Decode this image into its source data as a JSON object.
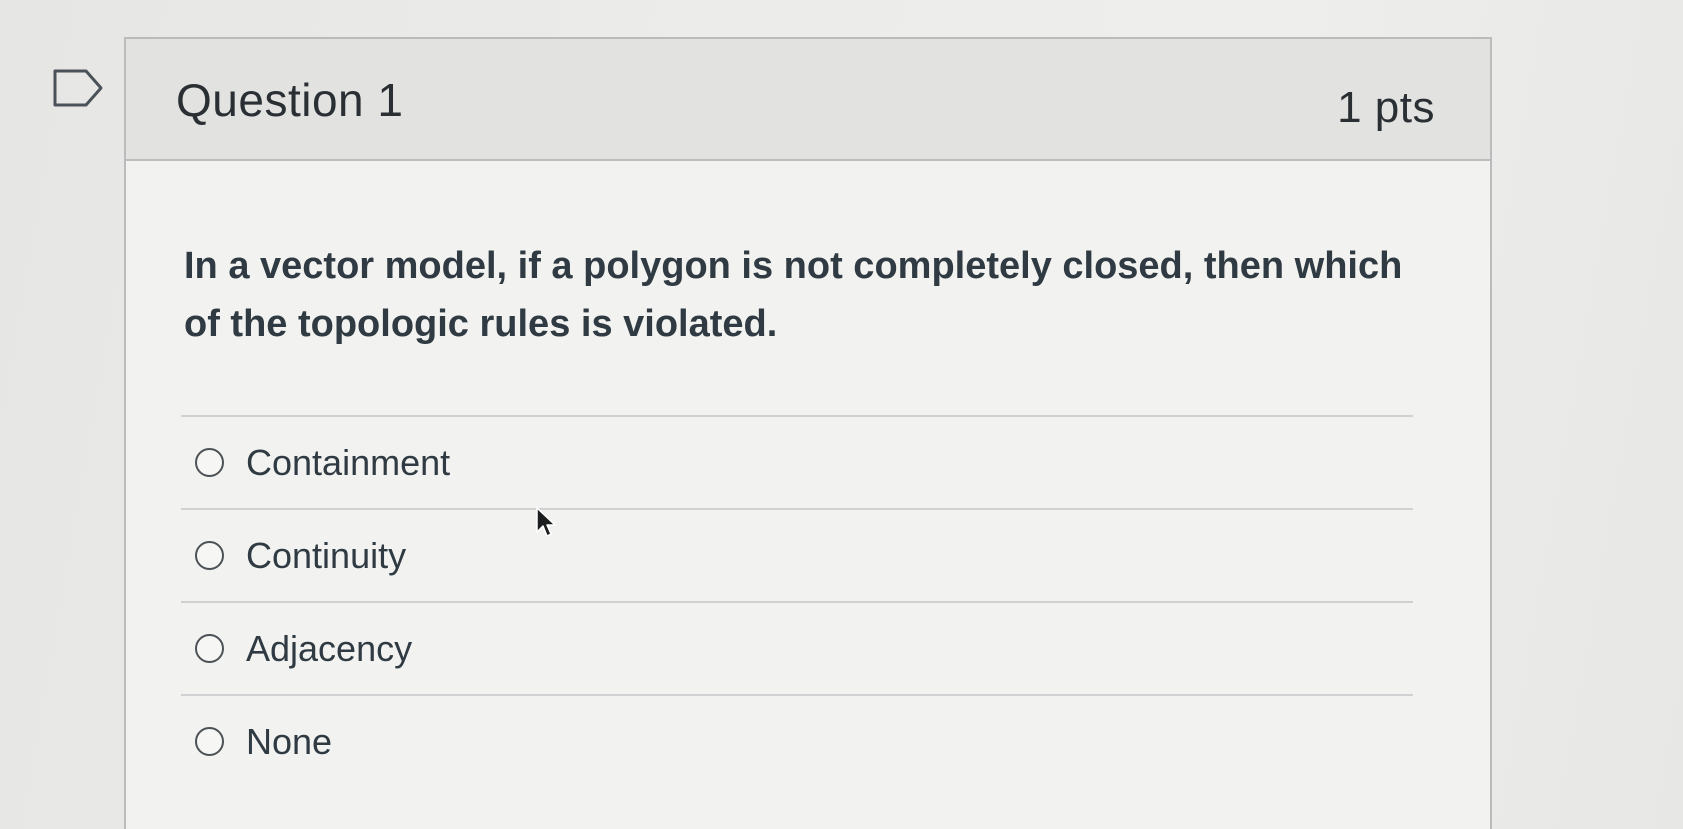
{
  "question": {
    "title": "Question 1",
    "points": "1 pts",
    "text": "In a vector model, if a polygon is not completely closed, then which of the topologic rules is violated."
  },
  "answers": [
    {
      "label": "Containment",
      "selected": false
    },
    {
      "label": "Continuity",
      "selected": false
    },
    {
      "label": "Adjacency",
      "selected": false
    },
    {
      "label": "None",
      "selected": false
    }
  ],
  "icons": {
    "flag": "flag-question-icon",
    "cursor": "mouse-pointer-icon"
  },
  "colors": {
    "header_bg": "#e2e2e0",
    "text": "#2f3a42",
    "border": "#b9bbbd"
  }
}
